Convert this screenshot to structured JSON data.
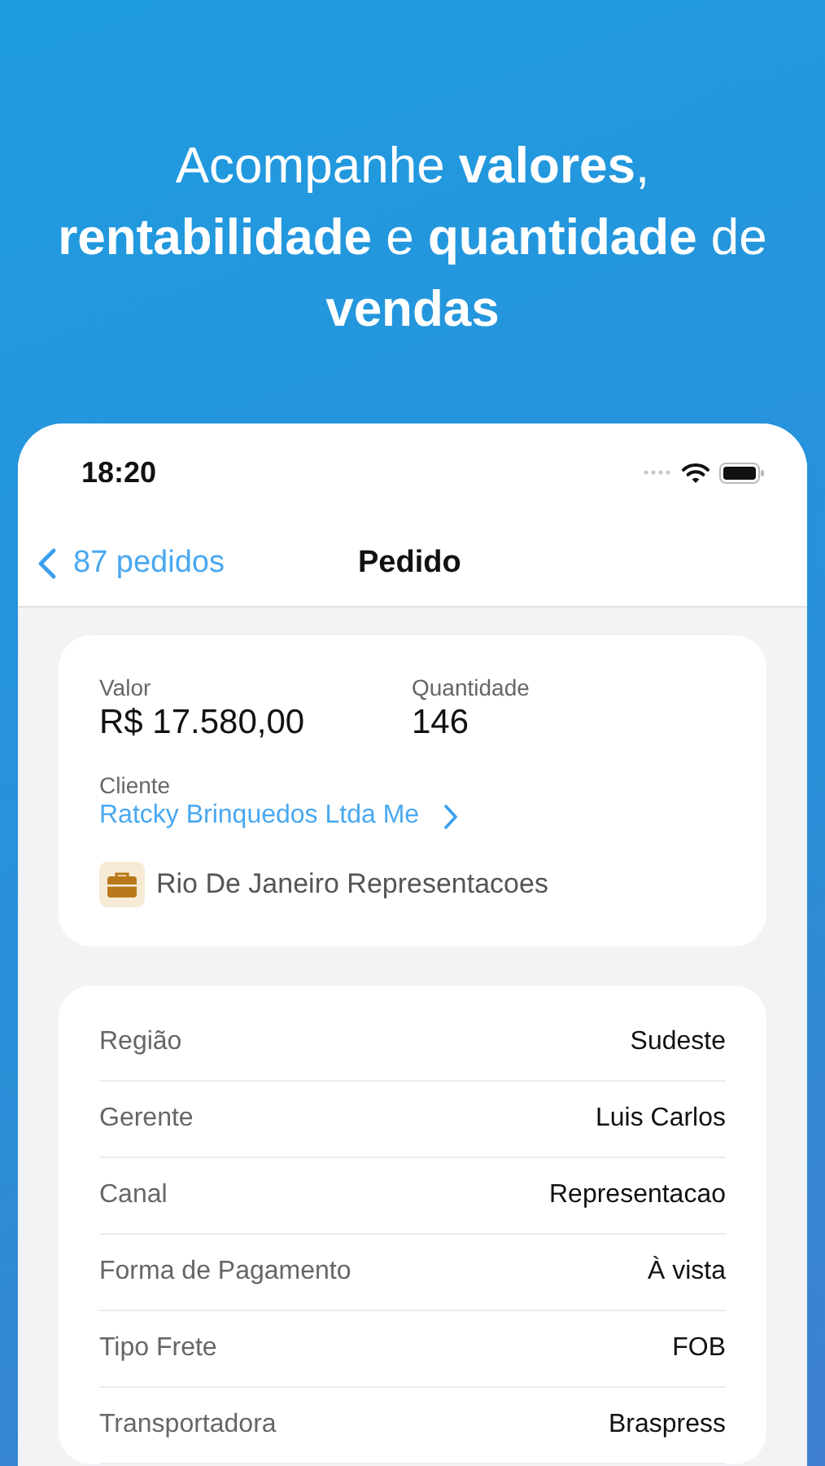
{
  "headline": "Acompanhe **valores**, **rentabilidade** e **quantidade** de **vendas**",
  "status_bar": {
    "time": "18:20"
  },
  "nav": {
    "back_label": "87 pedidos",
    "title": "Pedido"
  },
  "summary": {
    "fields": [
      {
        "label": "Valor",
        "value": "R$ 17.580,00"
      },
      {
        "label": "Quantidade",
        "value": "146"
      }
    ],
    "client_label": "Cliente",
    "client_name": "Ratcky Brinquedos Ltda Me",
    "representative": "Rio De Janeiro Representacoes"
  },
  "details": [
    {
      "label": "Região",
      "value": "Sudeste"
    },
    {
      "label": "Gerente",
      "value": "Luis Carlos"
    },
    {
      "label": "Canal",
      "value": "Representacao"
    },
    {
      "label": "Forma de Pagamento",
      "value": "À vista"
    },
    {
      "label": "Tipo Frete",
      "value": "FOB"
    },
    {
      "label": "Transportadora",
      "value": "Braspress"
    }
  ]
}
